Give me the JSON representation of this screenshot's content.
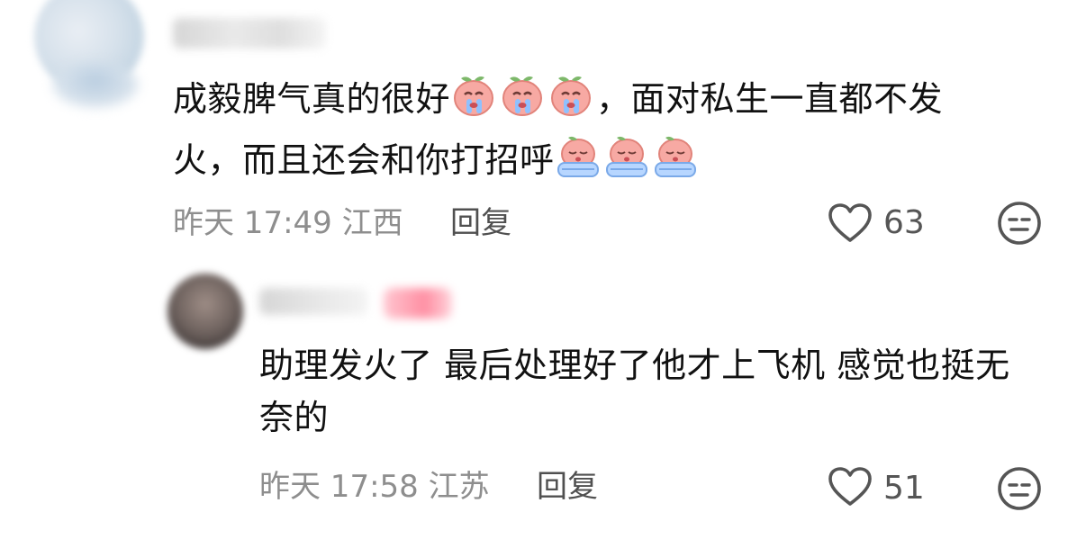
{
  "comments": [
    {
      "text_part1": "成毅脾气真的很好",
      "emoji_group1": "crying-peach",
      "text_part2": "，面对私生一直都不发火，而且还会和你打招呼",
      "emoji_group2": "sobbing-peach",
      "time": "昨天 17:49",
      "location": "江西",
      "reply_label": "回复",
      "likes": "63"
    },
    {
      "text": "助理发火了 最后处理好了他才上飞机 感觉也挺无奈的",
      "time": "昨天 17:58",
      "location": "江苏",
      "reply_label": "回复",
      "likes": "51"
    }
  ],
  "icons": {
    "like": "heart-outline-icon",
    "dislike": "meh-face-icon"
  },
  "colors": {
    "text": "#111111",
    "meta": "#8e8e8e",
    "reply": "#505050",
    "icon": "#555555",
    "emoji_peach": "#f7a9a3",
    "emoji_leaf": "#7db86a",
    "emoji_tears": "#8fc1ff"
  }
}
